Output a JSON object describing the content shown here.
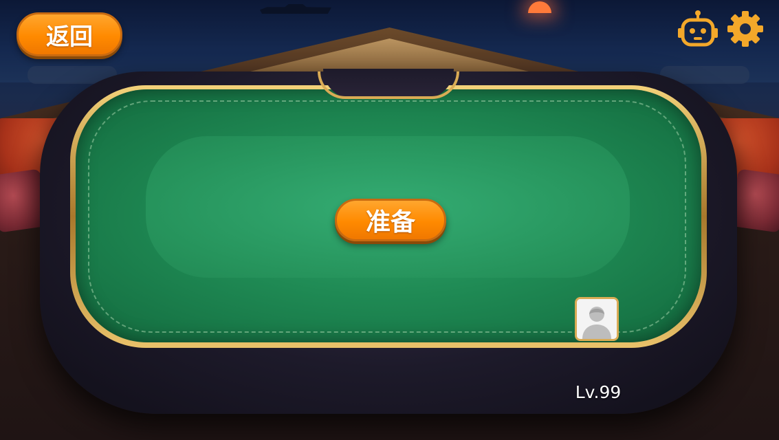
{
  "header": {
    "back_label": "返回",
    "robot_icon": "robot-icon",
    "settings_icon": "gear-icon"
  },
  "table": {
    "ready_label": "准备"
  },
  "player": {
    "avatar_icon": "default-avatar-icon",
    "level": "Lv.99"
  },
  "colors": {
    "accent_orange": "#ff8a00",
    "felt_green": "#1f8a54",
    "gold": "#d9ab55"
  }
}
